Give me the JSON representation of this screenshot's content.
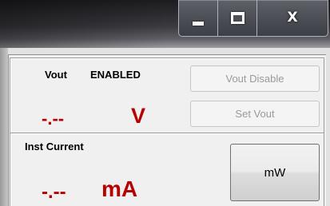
{
  "window": {
    "minimize_icon": "minimize-icon",
    "maximize_icon": "maximize-icon",
    "close_icon": "close-icon",
    "close_glyph": "X"
  },
  "vout_group": {
    "label": "Vout",
    "status": "ENABLED",
    "value": "-.--",
    "unit": "V",
    "disable_button": "Vout Disable",
    "set_button": "Set Vout"
  },
  "current_group": {
    "label": "Inst Current",
    "value": "-.--",
    "unit": "mA",
    "unit_button": "mW"
  },
  "colors": {
    "value_red": "#b80000",
    "disabled_text": "#9a9a9a"
  }
}
